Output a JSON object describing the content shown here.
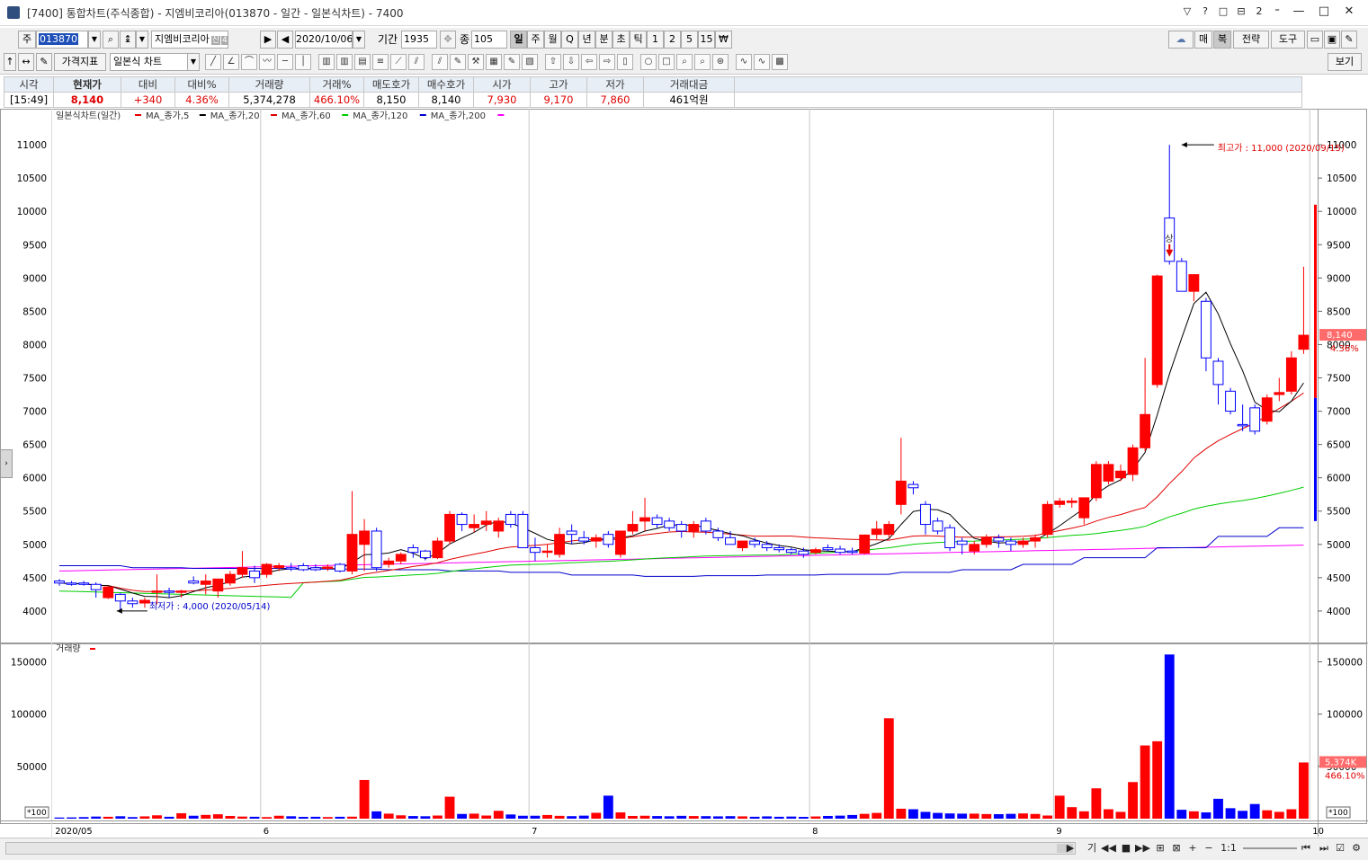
{
  "window": {
    "title": "[7400] 통합차트(주식종합) - 지엠비코리아(013870 - 일간 - 일본식차트) - 7400",
    "buttons": [
      "▽",
      "?",
      "□",
      "⊟",
      "2",
      "⁼"
    ]
  },
  "toolbar1": {
    "market_label": "주",
    "code": "013870",
    "stock_name": "지엠비코리아",
    "badge1": "신",
    "badge2": "40",
    "date": "2020/10/06",
    "period_label": "기간",
    "period_value": "1935",
    "count_label": "종",
    "count_value": "105",
    "intervals": [
      "일",
      "주",
      "월",
      "Q",
      "년",
      "분",
      "초",
      "틱",
      "1",
      "2",
      "5",
      "15",
      "₩"
    ],
    "right_buttons": [
      "매",
      "복",
      "전략",
      "도구"
    ]
  },
  "toolbar2": {
    "indicator_label": "가격지표",
    "chart_type": "일본식 차트",
    "view_label": "보기"
  },
  "info": {
    "headers": [
      "시각",
      "현재가",
      "대비",
      "대비%",
      "거래량",
      "거래%",
      "매도호가",
      "매수호가",
      "시가",
      "고가",
      "저가",
      "거래대금"
    ],
    "values": [
      "[15:49]",
      "8,140",
      "+340",
      "4.36%",
      "5,374,278",
      "466.10%",
      "8,150",
      "8,140",
      "7,930",
      "9,170",
      "7,860",
      "461억원"
    ]
  },
  "colors": {
    "up": "#ff0000",
    "down": "#0000ff",
    "ma5": "#000000",
    "ma20": "#e00000",
    "ma60": "#00cc00",
    "ma120": "#0000cc",
    "ma200": "#ff00ff"
  },
  "chart_data": {
    "type": "candlestick",
    "price_legend_title": "일본식차트(일간)",
    "legend": [
      "MA_종가,5",
      "MA_종가,20",
      "MA_종가,60",
      "MA_종가,120",
      "MA_종가,200"
    ],
    "volume_legend_title": "거래량",
    "price_ticks": [
      4000,
      4500,
      5000,
      5500,
      6000,
      6500,
      7000,
      7500,
      8000,
      8500,
      9000,
      9500,
      10000,
      10500,
      11000
    ],
    "price_ylim": [
      3540,
      11460
    ],
    "volume_ticks": [
      50000,
      100000,
      150000
    ],
    "volume_ylim": [
      0,
      165000
    ],
    "volume_unit": "*100",
    "x_labels": [
      {
        "label": "2020/05",
        "index": 0
      },
      {
        "label": "6",
        "index": 17
      },
      {
        "label": "7",
        "index": 39
      },
      {
        "label": "8",
        "index": 62
      },
      {
        "label": "9",
        "index": 82
      },
      {
        "label": "10",
        "index": 103
      }
    ],
    "high_annotation": {
      "text": "최고가 : 11,000 (2020/09/15)",
      "index": 92,
      "value": 11000
    },
    "low_annotation": {
      "text": "최저가 : 4,000 (2020/05/14)",
      "index": 5,
      "value": 4000
    },
    "limit_up_mark": {
      "text": "상",
      "index": 91
    },
    "current_price_label": "8,140",
    "current_change_label": "4.36%",
    "current_volume_label": "5,374K",
    "current_volume_pct_label": "466.10%",
    "candles": [
      {
        "o": 4450,
        "h": 4480,
        "l": 4380,
        "c": 4420
      },
      {
        "o": 4420,
        "h": 4450,
        "l": 4380,
        "c": 4400
      },
      {
        "o": 4420,
        "h": 4450,
        "l": 4380,
        "c": 4410
      },
      {
        "o": 4400,
        "h": 4430,
        "l": 4200,
        "c": 4320
      },
      {
        "o": 4200,
        "h": 4380,
        "l": 4180,
        "c": 4360
      },
      {
        "o": 4250,
        "h": 4270,
        "l": 4000,
        "c": 4150
      },
      {
        "o": 4150,
        "h": 4200,
        "l": 4050,
        "c": 4110
      },
      {
        "o": 4120,
        "h": 4200,
        "l": 4050,
        "c": 4160
      },
      {
        "o": 4280,
        "h": 4550,
        "l": 4100,
        "c": 4300
      },
      {
        "o": 4300,
        "h": 4350,
        "l": 4200,
        "c": 4280
      },
      {
        "o": 4280,
        "h": 4320,
        "l": 4200,
        "c": 4300
      },
      {
        "o": 4450,
        "h": 4520,
        "l": 4400,
        "c": 4420
      },
      {
        "o": 4400,
        "h": 4550,
        "l": 4250,
        "c": 4450
      },
      {
        "o": 4300,
        "h": 4480,
        "l": 4200,
        "c": 4480
      },
      {
        "o": 4420,
        "h": 4600,
        "l": 4380,
        "c": 4550
      },
      {
        "o": 4550,
        "h": 4900,
        "l": 4500,
        "c": 4650
      },
      {
        "o": 4600,
        "h": 4680,
        "l": 4420,
        "c": 4500
      },
      {
        "o": 4550,
        "h": 4720,
        "l": 4500,
        "c": 4700
      },
      {
        "o": 4650,
        "h": 4720,
        "l": 4600,
        "c": 4680
      },
      {
        "o": 4650,
        "h": 4720,
        "l": 4600,
        "c": 4640
      },
      {
        "o": 4680,
        "h": 4720,
        "l": 4600,
        "c": 4620
      },
      {
        "o": 4650,
        "h": 4700,
        "l": 4600,
        "c": 4620
      },
      {
        "o": 4640,
        "h": 4700,
        "l": 4600,
        "c": 4660
      },
      {
        "o": 4700,
        "h": 4720,
        "l": 4580,
        "c": 4600
      },
      {
        "o": 4600,
        "h": 5800,
        "l": 4550,
        "c": 5150
      },
      {
        "o": 5000,
        "h": 5380,
        "l": 4600,
        "c": 5200
      },
      {
        "o": 5200,
        "h": 5250,
        "l": 4600,
        "c": 4650
      },
      {
        "o": 4700,
        "h": 4800,
        "l": 4650,
        "c": 4750
      },
      {
        "o": 4750,
        "h": 4880,
        "l": 4700,
        "c": 4850
      },
      {
        "o": 4950,
        "h": 5000,
        "l": 4800,
        "c": 4880
      },
      {
        "o": 4900,
        "h": 4920,
        "l": 4760,
        "c": 4800
      },
      {
        "o": 4800,
        "h": 5100,
        "l": 4780,
        "c": 5050
      },
      {
        "o": 5050,
        "h": 5500,
        "l": 5000,
        "c": 5450
      },
      {
        "o": 5450,
        "h": 5480,
        "l": 5200,
        "c": 5300
      },
      {
        "o": 5250,
        "h": 5450,
        "l": 5180,
        "c": 5300
      },
      {
        "o": 5300,
        "h": 5500,
        "l": 5200,
        "c": 5350
      },
      {
        "o": 5200,
        "h": 5400,
        "l": 5100,
        "c": 5350
      },
      {
        "o": 5450,
        "h": 5500,
        "l": 5250,
        "c": 5300
      },
      {
        "o": 5450,
        "h": 5500,
        "l": 5200,
        "c": 4950
      },
      {
        "o": 4950,
        "h": 5100,
        "l": 4750,
        "c": 4880
      },
      {
        "o": 4900,
        "h": 5000,
        "l": 4800,
        "c": 4900
      },
      {
        "o": 4850,
        "h": 5250,
        "l": 4800,
        "c": 5150
      },
      {
        "o": 5200,
        "h": 5300,
        "l": 5000,
        "c": 5150
      },
      {
        "o": 5100,
        "h": 5200,
        "l": 5000,
        "c": 5050
      },
      {
        "o": 5050,
        "h": 5150,
        "l": 4950,
        "c": 5100
      },
      {
        "o": 5150,
        "h": 5200,
        "l": 4950,
        "c": 5000
      },
      {
        "o": 4850,
        "h": 5200,
        "l": 4800,
        "c": 5200
      },
      {
        "o": 5200,
        "h": 5500,
        "l": 5150,
        "c": 5300
      },
      {
        "o": 5350,
        "h": 5700,
        "l": 5200,
        "c": 5400
      },
      {
        "o": 5400,
        "h": 5450,
        "l": 5250,
        "c": 5300
      },
      {
        "o": 5350,
        "h": 5400,
        "l": 5200,
        "c": 5250
      },
      {
        "o": 5300,
        "h": 5350,
        "l": 5100,
        "c": 5200
      },
      {
        "o": 5200,
        "h": 5350,
        "l": 5100,
        "c": 5300
      },
      {
        "o": 5350,
        "h": 5400,
        "l": 5150,
        "c": 5200
      },
      {
        "o": 5200,
        "h": 5250,
        "l": 5050,
        "c": 5100
      },
      {
        "o": 5100,
        "h": 5200,
        "l": 5000,
        "c": 5000
      },
      {
        "o": 4950,
        "h": 5050,
        "l": 4900,
        "c": 5050
      },
      {
        "o": 5050,
        "h": 5100,
        "l": 4950,
        "c": 5000
      },
      {
        "o": 5000,
        "h": 5050,
        "l": 4900,
        "c": 4950
      },
      {
        "o": 4950,
        "h": 5000,
        "l": 4880,
        "c": 4920
      },
      {
        "o": 4920,
        "h": 4950,
        "l": 4850,
        "c": 4880
      },
      {
        "o": 4900,
        "h": 4950,
        "l": 4800,
        "c": 4850
      },
      {
        "o": 4880,
        "h": 4950,
        "l": 4850,
        "c": 4920
      },
      {
        "o": 4950,
        "h": 5000,
        "l": 4900,
        "c": 4920
      },
      {
        "o": 4930,
        "h": 4980,
        "l": 4850,
        "c": 4880
      },
      {
        "o": 4900,
        "h": 4950,
        "l": 4850,
        "c": 4880
      },
      {
        "o": 4870,
        "h": 5150,
        "l": 4850,
        "c": 5140
      },
      {
        "o": 5150,
        "h": 5350,
        "l": 5080,
        "c": 5230
      },
      {
        "o": 5150,
        "h": 5350,
        "l": 5100,
        "c": 5300
      },
      {
        "o": 5600,
        "h": 6600,
        "l": 5450,
        "c": 5950
      },
      {
        "o": 5900,
        "h": 5950,
        "l": 5750,
        "c": 5850
      },
      {
        "o": 5600,
        "h": 5650,
        "l": 5150,
        "c": 5300
      },
      {
        "o": 5350,
        "h": 5400,
        "l": 5150,
        "c": 5200
      },
      {
        "o": 5250,
        "h": 5300,
        "l": 4900,
        "c": 4950
      },
      {
        "o": 5050,
        "h": 5100,
        "l": 4850,
        "c": 5000
      },
      {
        "o": 4900,
        "h": 5050,
        "l": 4850,
        "c": 5000
      },
      {
        "o": 5000,
        "h": 5150,
        "l": 4950,
        "c": 5100
      },
      {
        "o": 5100,
        "h": 5150,
        "l": 4950,
        "c": 5050
      },
      {
        "o": 5050,
        "h": 5100,
        "l": 4900,
        "c": 5000
      },
      {
        "o": 5000,
        "h": 5100,
        "l": 4950,
        "c": 5050
      },
      {
        "o": 5050,
        "h": 5150,
        "l": 4950,
        "c": 5100
      },
      {
        "o": 5150,
        "h": 5650,
        "l": 5100,
        "c": 5600
      },
      {
        "o": 5600,
        "h": 5700,
        "l": 5550,
        "c": 5650
      },
      {
        "o": 5650,
        "h": 5700,
        "l": 5550,
        "c": 5650
      },
      {
        "o": 5400,
        "h": 5700,
        "l": 5300,
        "c": 5700
      },
      {
        "o": 5700,
        "h": 6250,
        "l": 5650,
        "c": 6200
      },
      {
        "o": 5950,
        "h": 6250,
        "l": 5900,
        "c": 6200
      },
      {
        "o": 6000,
        "h": 6200,
        "l": 5950,
        "c": 6100
      },
      {
        "o": 6050,
        "h": 6500,
        "l": 5950,
        "c": 6450
      },
      {
        "o": 6450,
        "h": 7800,
        "l": 6400,
        "c": 6950
      },
      {
        "o": 7400,
        "h": 9050,
        "l": 7350,
        "c": 9030
      },
      {
        "o": 9900,
        "h": 11000,
        "l": 9200,
        "c": 9250
      },
      {
        "o": 9250,
        "h": 9300,
        "l": 8800,
        "c": 8800
      },
      {
        "o": 8800,
        "h": 9050,
        "l": 8650,
        "c": 9050
      },
      {
        "o": 8650,
        "h": 8700,
        "l": 7600,
        "c": 7800
      },
      {
        "o": 7750,
        "h": 7800,
        "l": 7100,
        "c": 7400
      },
      {
        "o": 7300,
        "h": 7350,
        "l": 6950,
        "c": 7000
      },
      {
        "o": 6800,
        "h": 7100,
        "l": 6700,
        "c": 6780
      },
      {
        "o": 7050,
        "h": 7100,
        "l": 6650,
        "c": 6700
      },
      {
        "o": 6850,
        "h": 7250,
        "l": 6800,
        "c": 7200
      },
      {
        "o": 7250,
        "h": 7500,
        "l": 7150,
        "c": 7280
      },
      {
        "o": 7300,
        "h": 7900,
        "l": 7250,
        "c": 7800
      },
      {
        "o": 7930,
        "h": 9170,
        "l": 7860,
        "c": 8140
      }
    ],
    "volumes": [
      1100,
      1200,
      1500,
      2000,
      1800,
      2300,
      1500,
      2200,
      3200,
      1800,
      5200,
      2800,
      3600,
      4200,
      2600,
      2000,
      1800,
      1500,
      2800,
      2300,
      1700,
      1800,
      1500,
      1800,
      1900,
      37000,
      7000,
      4800,
      3200,
      2500,
      2300,
      3000,
      21000,
      4500,
      4800,
      3000,
      7500,
      4000,
      2800,
      2800,
      3500,
      2700,
      2400,
      2900,
      5600,
      22000,
      6000,
      2600,
      2800,
      2500,
      2300,
      2700,
      2500,
      2400,
      2200,
      2400,
      2200,
      1800,
      2200,
      1800,
      2000,
      1700,
      2100,
      2600,
      2900,
      3500,
      4600,
      5500,
      96000,
      9500,
      9000,
      6500,
      5500,
      5000,
      4800,
      4800,
      4400,
      4300,
      4600,
      5000,
      4500,
      3000,
      22000,
      11000,
      7000,
      29000,
      9000,
      6500,
      35000,
      70000,
      74000,
      157000,
      8500,
      7000,
      6000,
      19000,
      10000,
      7500,
      14000,
      8000,
      6500,
      9000,
      53743
    ]
  }
}
